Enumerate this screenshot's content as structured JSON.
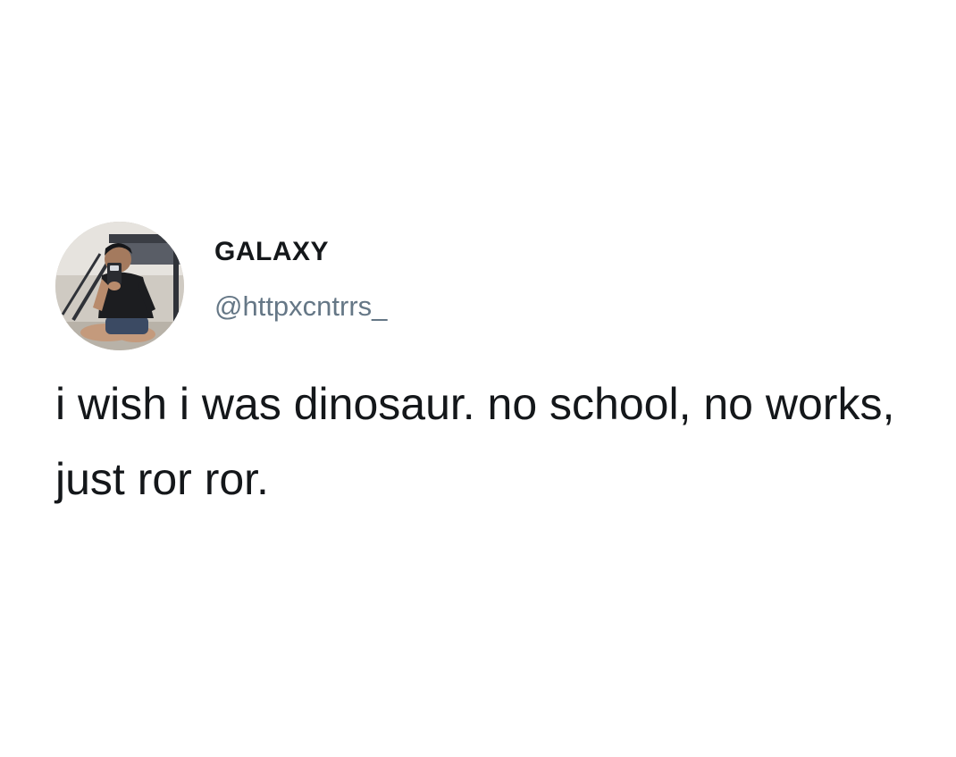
{
  "tweet": {
    "author": {
      "display_name": "GALAXY",
      "handle": "@httpxcntrrs_",
      "avatar_icon": "profile-photo"
    },
    "text": "i wish i was dinosaur. no school, no works, just ror ror."
  },
  "colors": {
    "background": "#ffffff",
    "text_primary": "#14171a",
    "text_secondary": "#657786"
  }
}
